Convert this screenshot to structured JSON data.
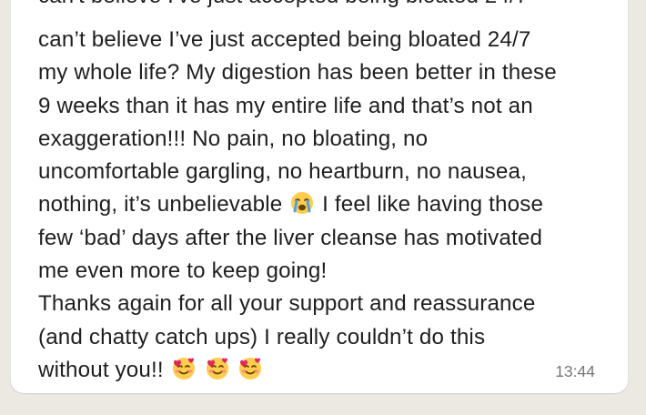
{
  "message": {
    "cut_off_line": "can't believe I've just accepted being bloated 24/7",
    "lines": [
      "can’t believe I’ve just accepted being bloated 24/7",
      "my whole life? My digestion has been better in these",
      "9 weeks than it has my entire life and that’s not an",
      "exaggeration!!! No pain, no bloating, no",
      "uncomfortable gargling, no heartburn, no nausea,",
      "nothing, it’s unbelievable",
      "I feel like having those",
      "few ‘bad’ days after the liver cleanse has motivated",
      "me even more to keep going!",
      "Thanks again for all your support and reassurance",
      "(and chatty catch ups) I really couldn’t do this",
      "without you!!"
    ],
    "time": "13:44",
    "emojis": {
      "crying": "loudly-crying-face-icon",
      "hearts": "smiling-face-with-hearts-icon"
    }
  },
  "colors": {
    "background": "#ece9e3",
    "bubble": "#ffffff",
    "text": "#1f1f1f",
    "timestamp": "#757575"
  }
}
